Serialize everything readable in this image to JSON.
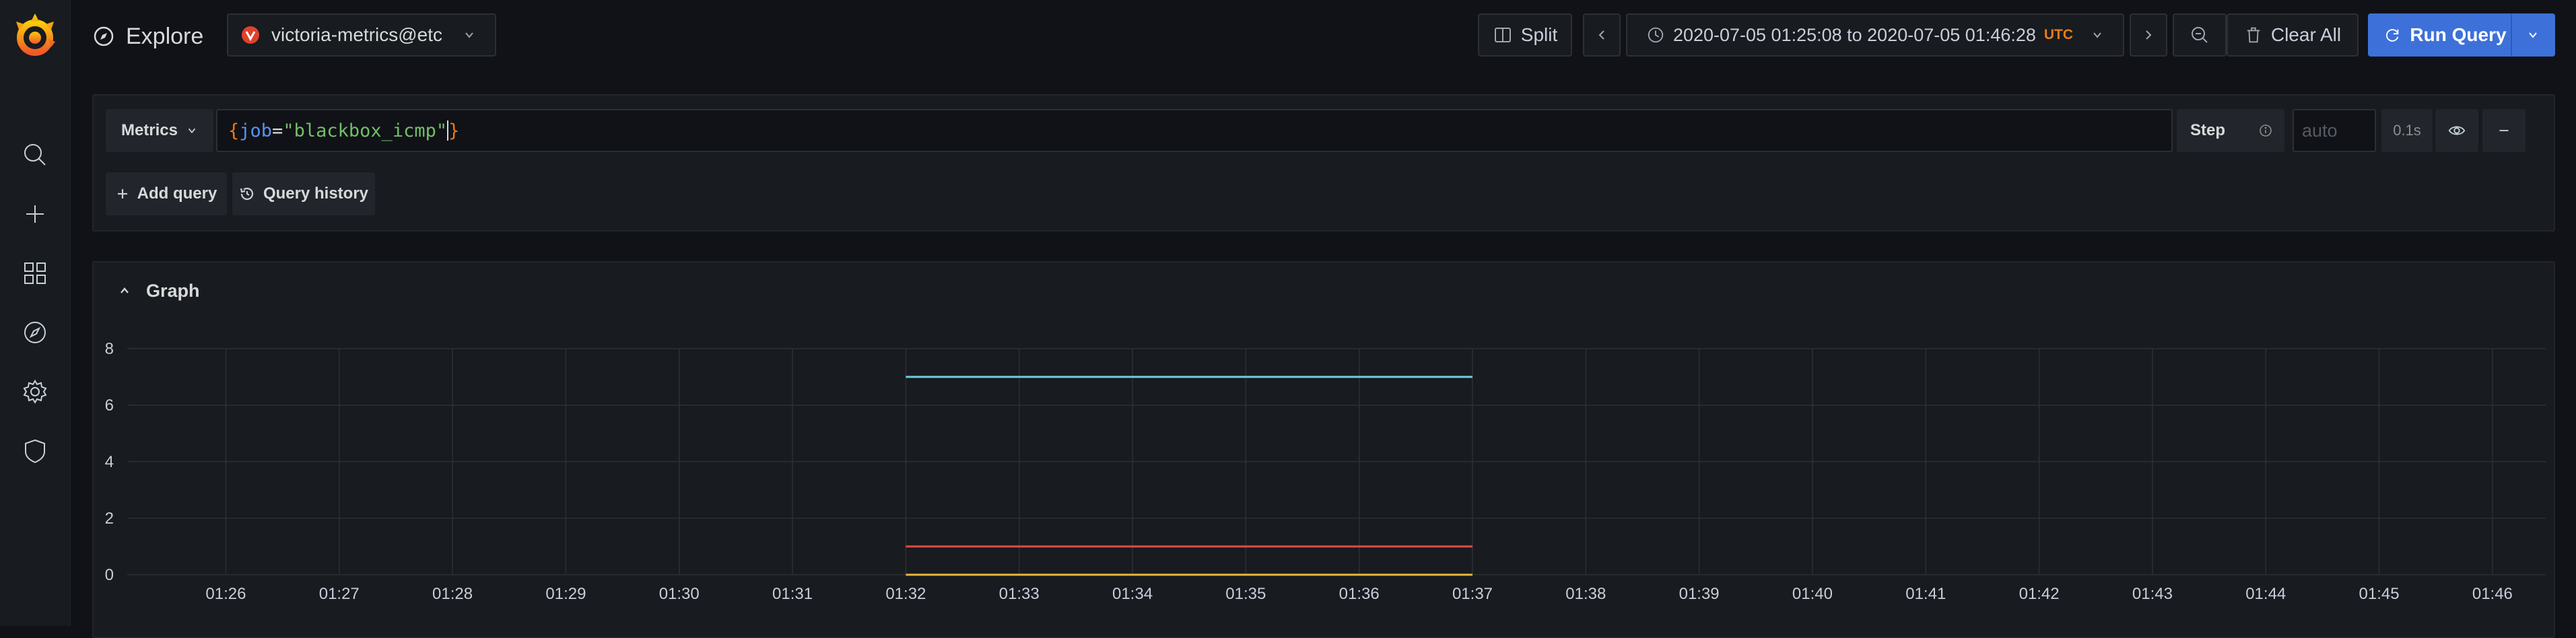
{
  "app": {
    "page_title": "Explore",
    "datasource": "victoria-metrics@etc"
  },
  "toolbar": {
    "split_label": "Split",
    "time_range_label": "2020-07-05 01:25:08 to 2020-07-05 01:46:28",
    "timezone": "UTC",
    "clear_all_label": "Clear All",
    "run_query_label": "Run Query"
  },
  "query": {
    "type_label": "Metrics",
    "expr_label_name": "job",
    "expr_operator": "=",
    "expr_value": "\"blackbox_icmp\"",
    "step_label": "Step",
    "step_placeholder": "auto",
    "query_time": "0.1s",
    "add_query_label": "Add query",
    "query_history_label": "Query history"
  },
  "graph": {
    "title": "Graph"
  },
  "colors": {
    "accent": "#3d71d9",
    "timezone": "#eb7b18",
    "brace": "#eb7b18",
    "label": "#5794f2",
    "string": "#73bf69"
  },
  "icons": [
    "grafana-logo",
    "search-icon",
    "plus-icon",
    "dashboards-icon",
    "explore-icon",
    "gear-icon",
    "shield-icon",
    "compass-icon",
    "split-icon",
    "chevron-left-icon",
    "clock-icon",
    "chevron-down-icon",
    "chevron-right-icon",
    "zoom-out-icon",
    "trash-icon",
    "refresh-icon",
    "info-icon",
    "eye-icon",
    "minus-icon",
    "history-icon",
    "chevron-up-icon"
  ],
  "chart_data": {
    "type": "line",
    "title": "",
    "xlabel": "",
    "ylabel": "",
    "x_ticks": [
      "01:26",
      "01:27",
      "01:28",
      "01:29",
      "01:30",
      "01:31",
      "01:32",
      "01:33",
      "01:34",
      "01:35",
      "01:36",
      "01:37",
      "01:38",
      "01:39",
      "01:40",
      "01:41",
      "01:42",
      "01:43",
      "01:44",
      "01:45",
      "01:46"
    ],
    "xlim_minutes": [
      25.13,
      46.47
    ],
    "y_ticks": [
      0,
      2,
      4,
      6,
      8
    ],
    "ylim": [
      0,
      8
    ],
    "grid": true,
    "legend": "none",
    "series": [
      {
        "color": "#6ed0e0",
        "x_minutes": [
          32,
          37
        ],
        "values": [
          7,
          7
        ]
      },
      {
        "color": "#e24d42",
        "x_minutes": [
          32,
          37
        ],
        "values": [
          1,
          1
        ]
      },
      {
        "color": "#eab839",
        "x_minutes": [
          32,
          37
        ],
        "values": [
          0,
          0
        ]
      }
    ]
  }
}
